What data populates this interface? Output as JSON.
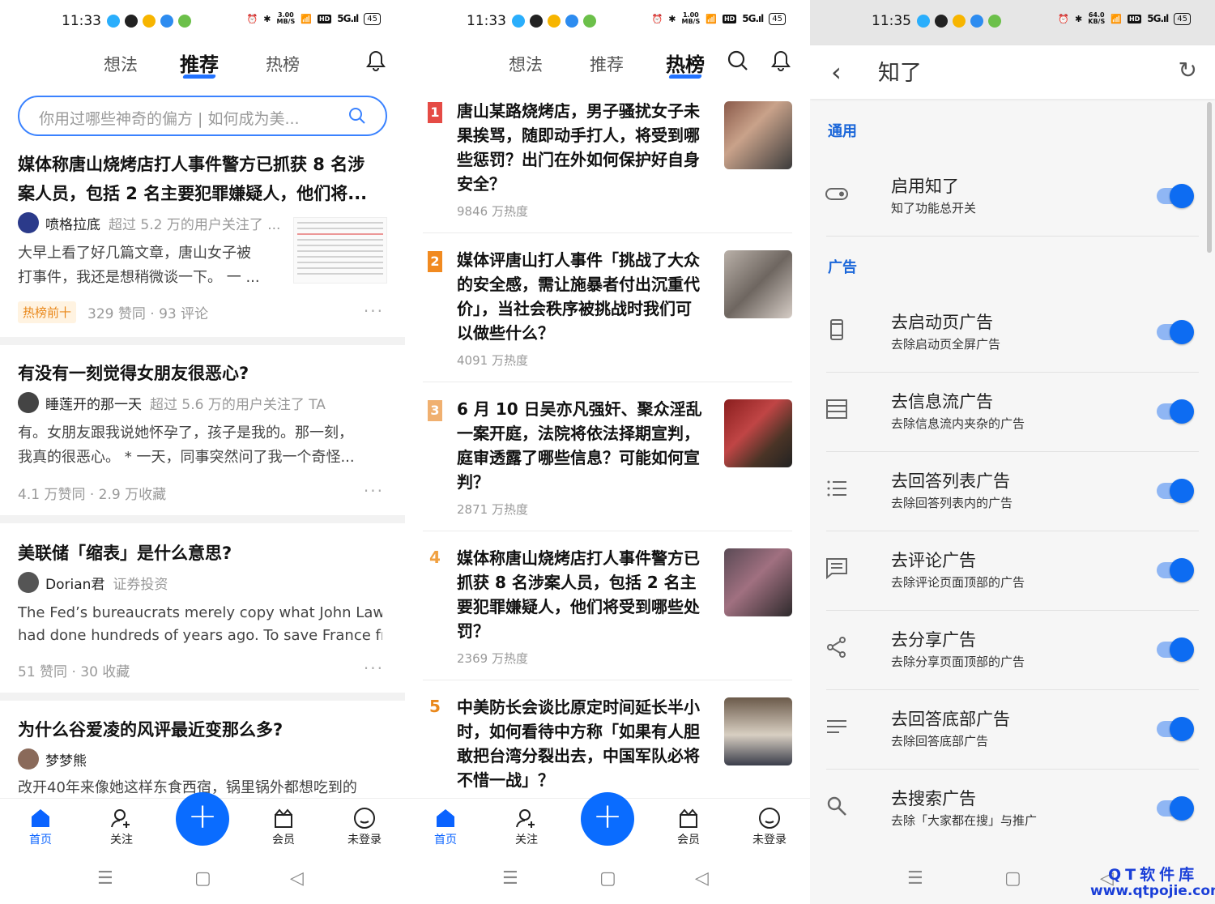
{
  "status": [
    {
      "time": "11:33",
      "speed": "3.00\nMB/S",
      "battery": "45"
    },
    {
      "time": "11:33",
      "speed": "1.00\nMB/S",
      "battery": "45"
    },
    {
      "time": "11:35",
      "speed": "64.0\nKB/S",
      "battery": "45"
    }
  ],
  "feed": {
    "tabs": [
      "想法",
      "推荐",
      "热榜"
    ],
    "search_placeholder": "你用过哪些神奇的偏方 | 如何成为美...",
    "cards": [
      {
        "title_lines": [
          "媒体称唐山烧烤店打人事件警方已抓获 8 名涉",
          "案人员，包括 2 名主要犯罪嫌疑人，他们将..."
        ],
        "author": "喷格拉底",
        "meta": "超过 5.2 万的用户关注了 ...",
        "excerpt_lines": [
          "大早上看了好几篇文章，唐山女子被",
          "打事件，我还是想稍微谈一下。 一 ..."
        ],
        "tag": "热榜前十",
        "stats": "329 赞同 · 93 评论"
      },
      {
        "title_lines": [
          "有没有一刻觉得女朋友很恶心?"
        ],
        "author": "睡莲开的那一天",
        "meta": "超过 5.6 万的用户关注了 TA",
        "excerpt_lines": [
          "有。女朋友跟我说她怀孕了，孩子是我的。那一刻，",
          "我真的很恶心。 * 一天，同事突然问了我一个奇怪..."
        ],
        "stats": "4.1 万赞同 · 2.9 万收藏"
      },
      {
        "title_lines": [
          "美联储「缩表」是什么意思?"
        ],
        "author": "Dorian君",
        "meta": "证券投资",
        "excerpt_lines": [
          "The Fed’s bureaucrats merely copy what John Law",
          "had done hundreds of years ago. To save France fr..."
        ],
        "stats": "51 赞同 · 30 收藏"
      },
      {
        "title_lines": [
          "为什么谷爱凌的风评最近变那么多?"
        ],
        "author": "梦梦熊",
        "meta": "",
        "excerpt_lines": [
          "改开40年来像她这样东食西宿，锅里锅外都想吃到的"
        ],
        "stats": ""
      }
    ]
  },
  "hot": {
    "items": [
      {
        "rank": "1",
        "title_lines": [
          "唐山某路烧烤店，男子骚扰女子未",
          "果挨骂，随即动手打人，将受到哪",
          "些惩罚？出门在外如何保护好自身",
          "安全？"
        ],
        "heat": "9846 万热度"
      },
      {
        "rank": "2",
        "title_lines": [
          "媒体评唐山打人事件「挑战了大众",
          "的安全感，需让施暴者付出沉重代",
          "价」，当社会秩序被挑战时我们可",
          "以做些什么？"
        ],
        "heat": "4091 万热度"
      },
      {
        "rank": "3",
        "title_lines": [
          "6 月 10 日吴亦凡强奸、聚众淫乱",
          "一案开庭，法院将依法择期宣判，",
          "庭审透露了哪些信息？可能如何宣",
          "判？"
        ],
        "heat": "2871 万热度"
      },
      {
        "rank": "4",
        "title_lines": [
          "媒体称唐山烧烤店打人事件警方已",
          "抓获 8 名涉案人员，包括 2 名主",
          "要犯罪嫌疑人，他们将受到哪些处",
          "罚？"
        ],
        "heat": "2369 万热度"
      },
      {
        "rank": "5",
        "title_lines": [
          "中美防长会谈比原定时间延长半小",
          "时，如何看待中方称「如果有人胆",
          "敢把台湾分裂出去，中国军队必将",
          "不惜一战」？"
        ],
        "heat": ""
      }
    ]
  },
  "bottom_nav": [
    "首页",
    "关注",
    "+",
    "会员",
    "未登录"
  ],
  "settings": {
    "title": "知了",
    "sections": [
      {
        "name": "通用",
        "rows": [
          {
            "title": "启用知了",
            "sub": "知了功能总开关",
            "icon": "toggle-icon",
            "on": true
          }
        ]
      },
      {
        "name": "广告",
        "rows": [
          {
            "title": "去启动页广告",
            "sub": "去除启动页全屏广告",
            "icon": "phone-icon",
            "on": true
          },
          {
            "title": "去信息流广告",
            "sub": "去除信息流内夹杂的广告",
            "icon": "feed-icon",
            "on": true
          },
          {
            "title": "去回答列表广告",
            "sub": "去除回答列表内的广告",
            "icon": "list-icon",
            "on": true
          },
          {
            "title": "去评论广告",
            "sub": "去除评论页面顶部的广告",
            "icon": "comment-icon",
            "on": true
          },
          {
            "title": "去分享广告",
            "sub": "去除分享页面顶部的广告",
            "icon": "share-icon",
            "on": true
          },
          {
            "title": "去回答底部广告",
            "sub": "去除回答底部广告",
            "icon": "lines-icon",
            "on": true
          },
          {
            "title": "去搜索广告",
            "sub": "去除「大家都在搜」与推广",
            "icon": "search-icon",
            "on": true
          }
        ]
      }
    ]
  },
  "watermark": {
    "line1": "QT软件库",
    "line2": "www.qtpojie.com"
  },
  "colors": {
    "accent": "#0a63ff",
    "toggle": "#0d6cf2",
    "hot1": "#e54b45",
    "hot2": "#f18a20"
  }
}
